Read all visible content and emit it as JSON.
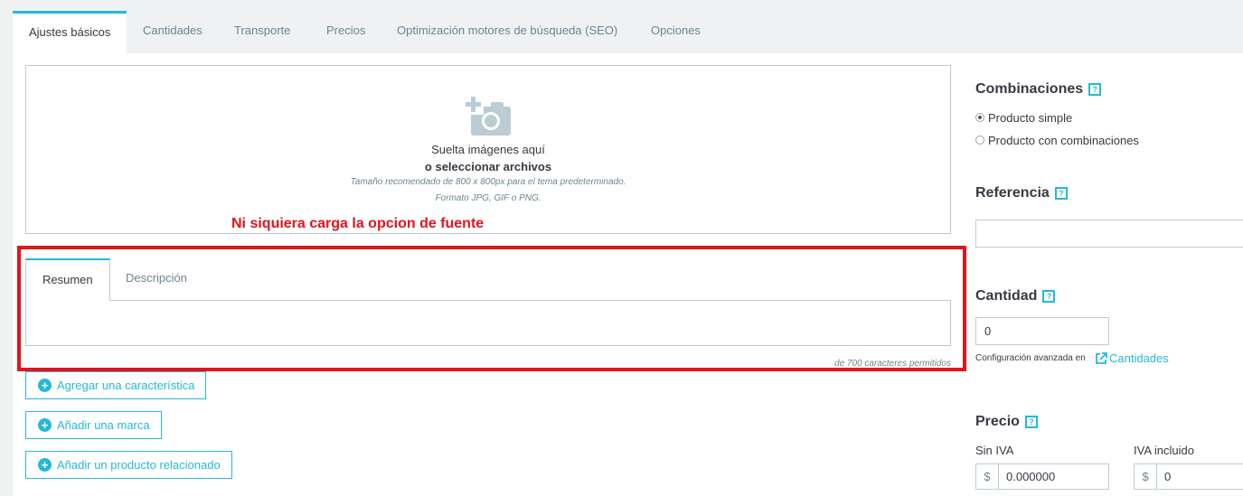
{
  "tabs": [
    {
      "label": "Ajustes básicos",
      "active": true
    },
    {
      "label": "Cantidades",
      "active": false
    },
    {
      "label": "Transporte",
      "active": false
    },
    {
      "label": "Precios",
      "active": false
    },
    {
      "label": "Optimización motores de búsqueda (SEO)",
      "active": false
    },
    {
      "label": "Opciones",
      "active": false
    }
  ],
  "dropzone": {
    "icon": "camera-add-icon",
    "line1": "Suelta imágenes aquí",
    "line2": "o seleccionar archivos",
    "line3": "Tamaño recomendado de 800 x 800px para el tema predeterminado.",
    "line4": "Formato JPG, GIF o PNG."
  },
  "annotation": "Ni siquiera carga la opcion de fuente",
  "description_tabs": {
    "summary": "Resumen",
    "description": "Descripción"
  },
  "char_counter": "de 700 caracteres permitidos",
  "buttons": {
    "add_feature": "Agregar una característica",
    "add_brand": "Añadir una marca",
    "add_related": "Añadir un producto relacionado"
  },
  "right": {
    "combinations": {
      "title": "Combinaciones",
      "option_simple": "Producto simple",
      "option_combinations": "Producto con combinaciones",
      "selected": "Producto simple"
    },
    "reference": {
      "title": "Referencia",
      "value": ""
    },
    "quantity": {
      "title": "Cantidad",
      "value": "0",
      "advanced_prefix": "Configuración avanzada en",
      "advanced_link": "Cantidades"
    },
    "price": {
      "title": "Precio",
      "tax_excl_label": "Sin IVA",
      "tax_incl_label": "IVA incluido",
      "currency": "$",
      "tax_excl_value": "0.000000",
      "tax_incl_value": "0"
    },
    "help_glyph": "?"
  },
  "colors": {
    "accent": "#25b9d7",
    "annotation_red": "#e2141d"
  }
}
